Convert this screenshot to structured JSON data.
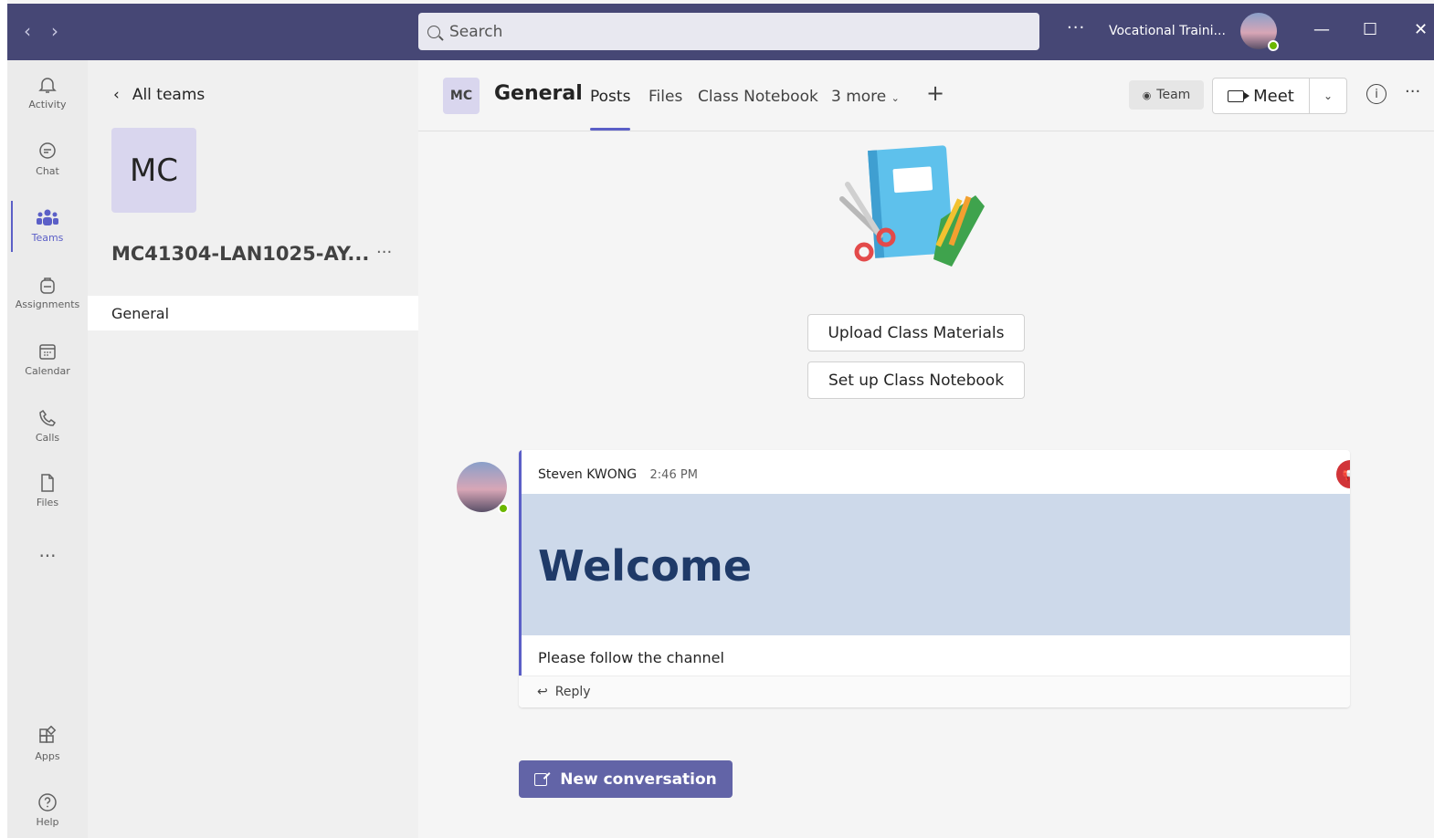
{
  "titlebar": {
    "search_placeholder": "Search",
    "more": "···",
    "org_name": "Vocational Traini...",
    "win_minimize": "—",
    "win_maximize": "☐",
    "win_close": "✕",
    "back_arrow": "‹",
    "forward_arrow": "›"
  },
  "rail": {
    "items": [
      {
        "label": "Activity",
        "icon": "bell-icon"
      },
      {
        "label": "Chat",
        "icon": "chat-icon"
      },
      {
        "label": "Teams",
        "icon": "teams-icon"
      },
      {
        "label": "Assignments",
        "icon": "backpack-icon"
      },
      {
        "label": "Calendar",
        "icon": "calendar-icon"
      },
      {
        "label": "Calls",
        "icon": "phone-icon"
      },
      {
        "label": "Files",
        "icon": "file-icon"
      }
    ],
    "more": "···",
    "bottom": [
      {
        "label": "Apps",
        "icon": "apps-icon"
      },
      {
        "label": "Help",
        "icon": "help-icon"
      }
    ],
    "active": "Teams"
  },
  "teampanel": {
    "back_label": "All teams",
    "team_initials": "MC",
    "team_name": "MC41304-LAN1025-AY...",
    "more": "···",
    "channels": [
      "General"
    ]
  },
  "header": {
    "channel_initials": "MC",
    "channel_name": "General",
    "tabs": [
      "Posts",
      "Files",
      "Class Notebook",
      "3 more"
    ],
    "active_tab": "Posts",
    "team_button": "Team",
    "meet_button": "Meet",
    "more": "···"
  },
  "actions": {
    "upload": "Upload Class Materials",
    "notebook": "Set up Class Notebook"
  },
  "post": {
    "author": "Steven KWONG",
    "time": "2:46 PM",
    "banner_title": "Welcome",
    "body": "Please follow the channel",
    "reply_label": "Reply"
  },
  "new_conversation": "New conversation",
  "colors": {
    "titlebar": "#464775",
    "accent": "#5b5fc7",
    "new_conv": "#6264a7",
    "announce": "#d13438"
  }
}
